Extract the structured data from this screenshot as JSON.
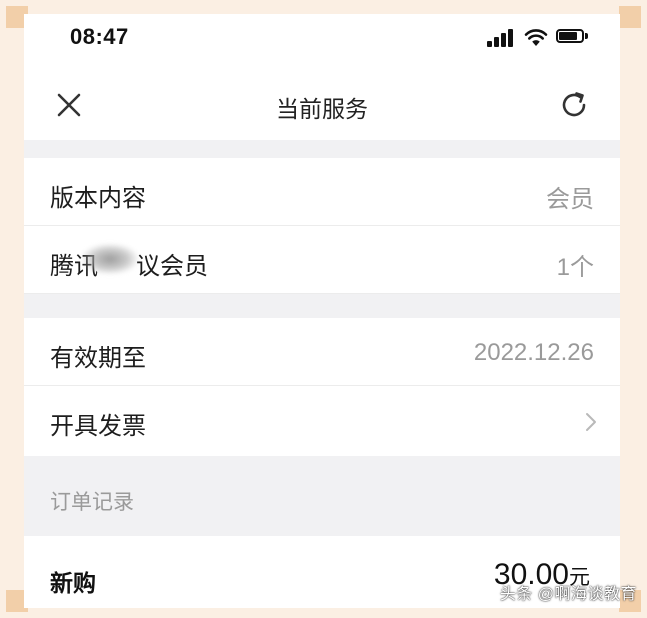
{
  "status_bar": {
    "time": "08:47",
    "icons": [
      "signal-icon",
      "wifi-icon",
      "battery-icon"
    ]
  },
  "nav": {
    "title": "当前服务",
    "close_icon": "close-icon",
    "refresh_icon": "refresh-icon"
  },
  "rows": {
    "version": {
      "label": "版本内容",
      "value": "会员"
    },
    "membership": {
      "label_start": "腾讯",
      "label_end": "议会员",
      "value": "1个"
    },
    "expiry": {
      "label": "有效期至",
      "value": "2022.12.26"
    },
    "invoice": {
      "label": "开具发票",
      "chevron_icon": "chevron-right-icon"
    }
  },
  "orders": {
    "section_label": "订单记录",
    "items": [
      {
        "type": "新购",
        "amount": "30.00",
        "unit": "元"
      }
    ]
  },
  "watermark": "头条 @啊海谈教育",
  "colors": {
    "background": "#ffffff",
    "section_gap": "#f1f1f3",
    "primary_text": "#1d1d1d",
    "secondary_text": "#9a9a9a",
    "frame": "#fbefe3"
  }
}
